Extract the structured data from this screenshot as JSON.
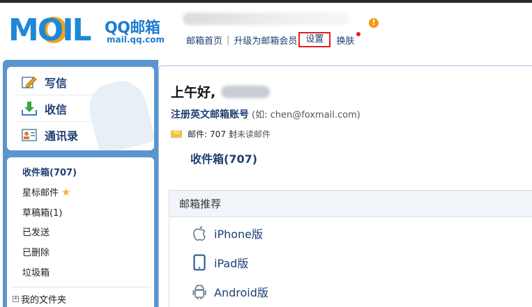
{
  "header": {
    "logo_brand": "MOIL",
    "logo_service": "QQ邮箱",
    "logo_url": "mail.qq.com",
    "notice_badge": "!",
    "nav": {
      "home": "邮箱首页",
      "separator": "|",
      "upgrade": "升级为邮箱会员",
      "settings": "设置",
      "skin": "换肤"
    }
  },
  "sidebar": {
    "compose": [
      {
        "label": "写信",
        "icon": "pencil-paper-icon"
      },
      {
        "label": "收信",
        "icon": "download-tray-icon"
      },
      {
        "label": "通讯录",
        "icon": "contact-card-icon"
      }
    ],
    "folders": [
      {
        "label": "收件箱(707)"
      },
      {
        "label": "星标邮件"
      },
      {
        "label": "草稿箱(1)"
      },
      {
        "label": "已发送"
      },
      {
        "label": "已删除"
      },
      {
        "label": "垃圾箱"
      }
    ],
    "my_folders": "我的文件夹",
    "expand_symbol": "+"
  },
  "main": {
    "greeting": "上午好,",
    "register_link": "注册英文邮箱账号",
    "register_hint": "(如: chen@foxmail.com)",
    "mail_label": "邮件:",
    "mail_count": "707",
    "mail_unit": "封",
    "mail_unread": "未读邮件",
    "inbox_link": "收件箱(707)",
    "recommend": {
      "title": "邮箱推荐",
      "items": [
        {
          "label": "iPhone版",
          "icon": "apple-icon"
        },
        {
          "label": "iPad版",
          "icon": "tablet-icon"
        },
        {
          "label": "Android版",
          "icon": "android-icon"
        }
      ]
    }
  },
  "colors": {
    "brand_blue": "#1e88d8",
    "link_blue": "#1d3f74",
    "sidebar_blue": "#5a95cf",
    "highlight_red": "#e02020",
    "star_gold": "#f4b52c"
  }
}
